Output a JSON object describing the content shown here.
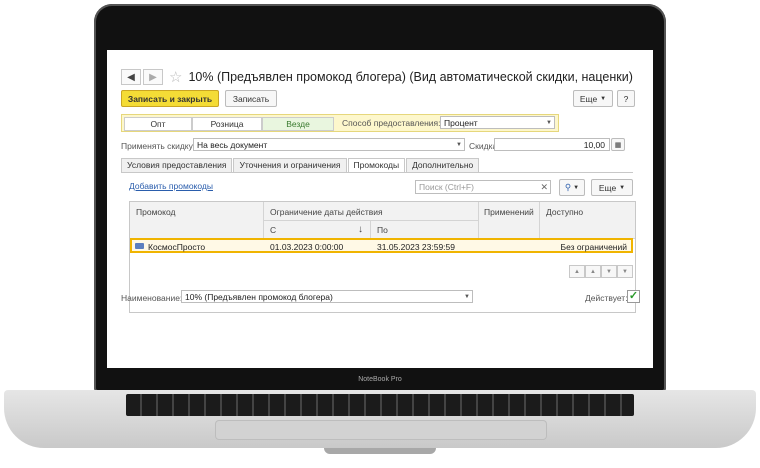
{
  "window": {
    "title": "10% (Предъявлен промокод блогера) (Вид автоматической скидки, наценки)"
  },
  "toolbar": {
    "save_close_label": "Записать и закрыть",
    "save_label": "Записать",
    "more_label": "Еще",
    "help_label": "?"
  },
  "segment": {
    "options": [
      "Опт",
      "Розница",
      "Везде"
    ],
    "selected": "Везде",
    "method_label": "Способ предоставления:",
    "method_value": "Процент"
  },
  "apply": {
    "label": "Применять скидку:",
    "value": "На весь документ",
    "discount_label": "Скидка:",
    "discount_value": "10,00"
  },
  "tabs": [
    "Условия предоставления",
    "Уточнения и ограничения",
    "Промокоды",
    "Дополнительно"
  ],
  "active_tab": "Промокоды",
  "promo": {
    "add_link": "Добавить промокоды",
    "search_placeholder": "Поиск (Ctrl+F)",
    "more_label": "Еще",
    "columns": {
      "promo": "Промокод",
      "date_limit": "Ограничение даты действия",
      "from": "С",
      "to": "По",
      "uses": "Применений",
      "available": "Доступно"
    },
    "rows": [
      {
        "promo": "КосмосПросто",
        "from": "01.03.2023 0:00:00",
        "to": "31.05.2023 23:59:59",
        "uses": "",
        "available": "Без ограничений"
      }
    ]
  },
  "name": {
    "label": "Наименование:",
    "value": "10% (Предъявлен промокод блогера)",
    "active_label": "Действует:",
    "active": true
  },
  "device": {
    "brand": "NoteBook Pro"
  },
  "colors": {
    "accent": "#f4dc36",
    "highlight_border": "#f0b400",
    "link": "#2a5dac"
  }
}
